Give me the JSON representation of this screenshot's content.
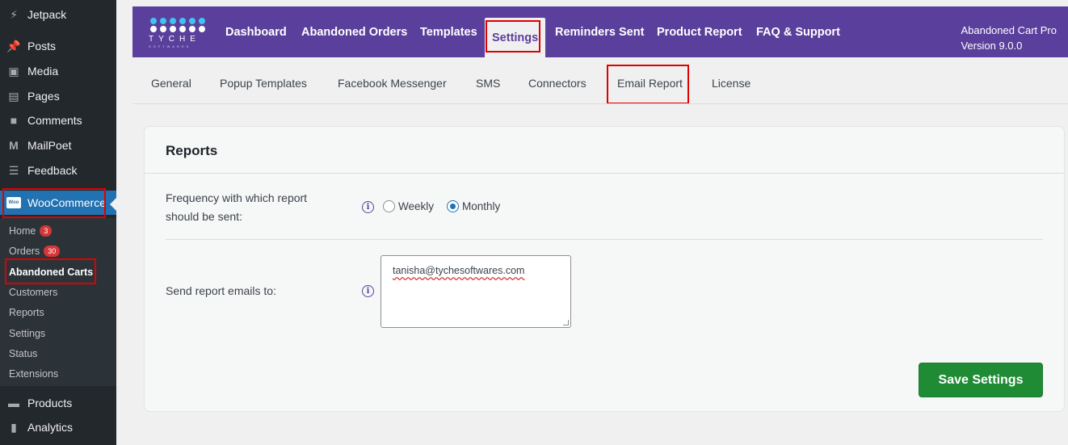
{
  "sidebar": {
    "items": [
      {
        "label": "Jetpack",
        "icon": "jetpack-icon"
      },
      {
        "label": "Posts",
        "icon": "pin-icon"
      },
      {
        "label": "Media",
        "icon": "media-icon"
      },
      {
        "label": "Pages",
        "icon": "pages-icon"
      },
      {
        "label": "Comments",
        "icon": "comment-icon"
      },
      {
        "label": "MailPoet",
        "icon": "mailpoet-icon"
      },
      {
        "label": "Feedback",
        "icon": "feedback-icon"
      },
      {
        "label": "WooCommerce",
        "icon": "woo-icon"
      },
      {
        "label": "Products",
        "icon": "products-icon"
      },
      {
        "label": "Analytics",
        "icon": "analytics-icon"
      }
    ],
    "woo_icon_text": "Woo",
    "submenu": [
      {
        "label": "Home",
        "badge": "3"
      },
      {
        "label": "Orders",
        "badge": "30"
      },
      {
        "label": "Abandoned Carts"
      },
      {
        "label": "Customers"
      },
      {
        "label": "Reports"
      },
      {
        "label": "Settings"
      },
      {
        "label": "Status"
      },
      {
        "label": "Extensions"
      }
    ]
  },
  "plugin_nav": {
    "brand": "TYCHE",
    "brand_sub": "SOFTWARES",
    "links": [
      "Dashboard",
      "Abandoned Orders",
      "Templates",
      "Settings",
      "Reminders Sent",
      "Product Report",
      "FAQ & Support"
    ],
    "active": "Settings",
    "product_name": "Abandoned Cart Pro",
    "version": "Version 9.0.0"
  },
  "sub_tabs": [
    "General",
    "Popup Templates",
    "Facebook Messenger",
    "SMS",
    "Connectors",
    "Email Report",
    "License"
  ],
  "active_sub_tab": "Email Report",
  "reports": {
    "title": "Reports",
    "frequency_label_line1": "Frequency with which report",
    "frequency_label_line2": "should be sent:",
    "options": [
      "Weekly",
      "Monthly"
    ],
    "selected": "Monthly",
    "emails_label": "Send report emails to:",
    "emails_value": "tanisha@tychesoftwares.com",
    "save_label": "Save Settings"
  },
  "colors": {
    "sidebar_bg": "#23282d",
    "accent_purple": "#5b3f9c",
    "save_green": "#1f8b35",
    "highlight_red": "#e00000"
  }
}
